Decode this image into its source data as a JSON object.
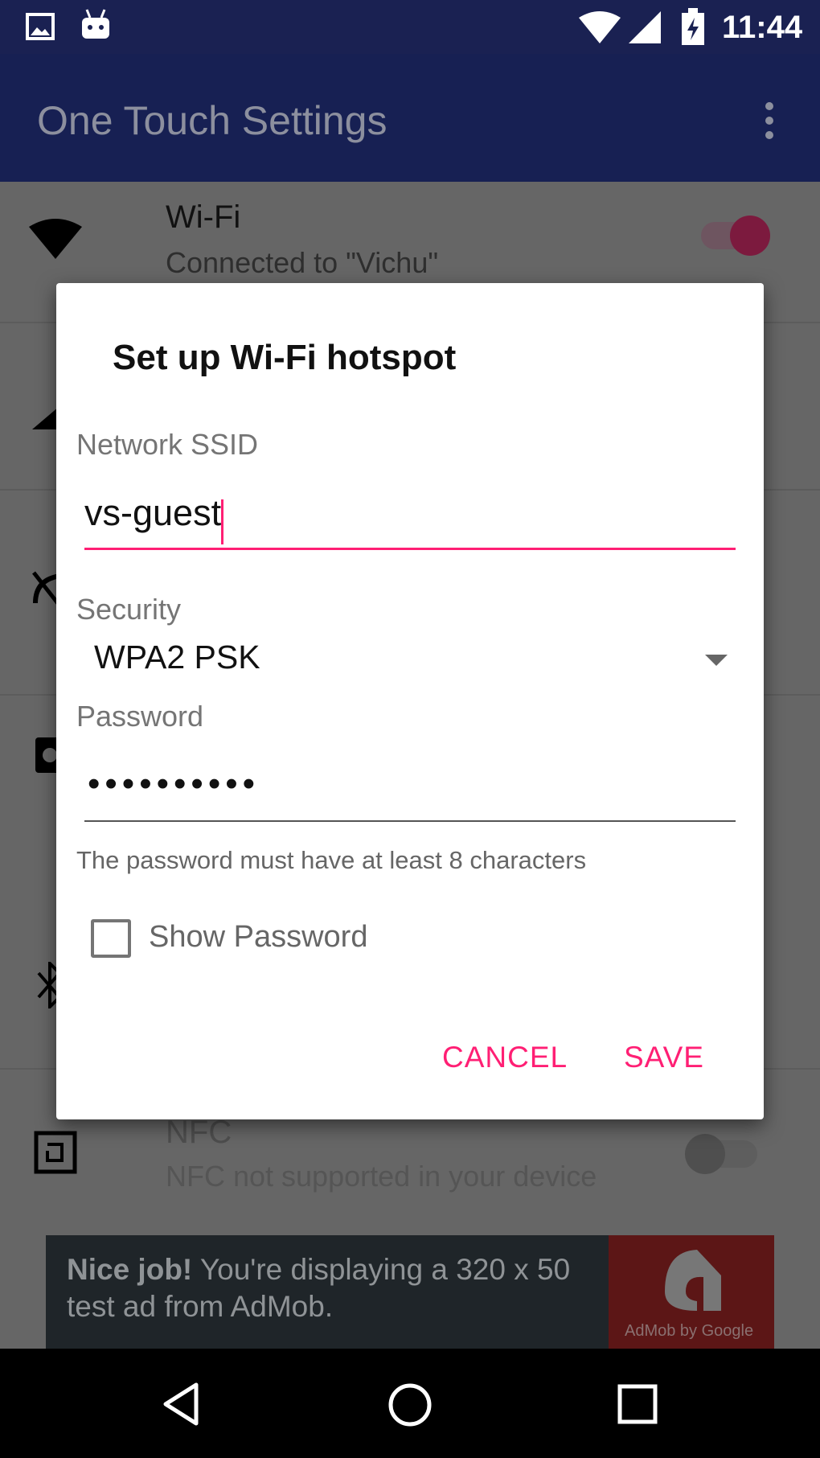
{
  "status_bar": {
    "time": "11:44",
    "icons": [
      "image-icon",
      "android-icon",
      "wifi-icon",
      "signal-icon",
      "battery-charging-icon"
    ]
  },
  "app_bar": {
    "title": "One Touch Settings",
    "menu_icon": "more-vert-icon",
    "color": "#3949ab"
  },
  "background_list": {
    "wifi": {
      "title": "Wi-Fi",
      "subtitle": "Connected to \"Vichu\"",
      "enabled": true
    },
    "nfc": {
      "title": "NFC",
      "subtitle": "NFC not supported in your device",
      "enabled": false
    }
  },
  "dialog": {
    "title": "Set up Wi-Fi hotspot",
    "ssid_label": "Network SSID",
    "ssid_value": "vs-guest",
    "security_label": "Security",
    "security_value": "WPA2 PSK",
    "password_label": "Password",
    "password_value": "••••••••••",
    "password_hint": "The password must have at least 8 characters",
    "show_password_label": "Show Password",
    "show_password_checked": false,
    "cancel_label": "CANCEL",
    "save_label": "SAVE",
    "accent": "#ff1f74"
  },
  "ad": {
    "bold": "Nice job!",
    "text": " You're displaying a 320 x 50 test ad from AdMob.",
    "brand": "AdMob by Google"
  },
  "nav_bar": {
    "icons": [
      "back-icon",
      "home-icon",
      "recents-icon"
    ]
  }
}
